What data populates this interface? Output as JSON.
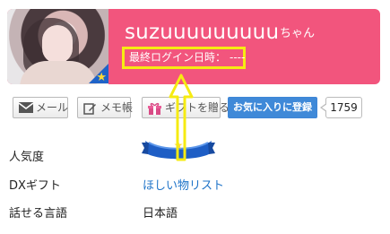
{
  "profile": {
    "name": "suzuuuuuuuuu",
    "honorific": "ちゃん",
    "last_login_label": "最終ログイン日時：",
    "last_login_value": "----"
  },
  "actions": {
    "mail_label": "メール",
    "memo_label": "メモ帳",
    "gift_label": "ギフトを贈る",
    "favorite_label": "お気に入りに登録",
    "favorite_count": "1759"
  },
  "details": {
    "popularity_label": "人気度",
    "gift_label": "DXギフト",
    "gift_value": "ほしい物リスト",
    "language_label": "話せる言語",
    "language_value": "日本語"
  },
  "colors": {
    "header": "#f2557d",
    "favorite": "#3f89d8",
    "highlight": "#f6eb12",
    "link": "#1e73c8"
  },
  "icons": {
    "mail": "mail-icon",
    "memo": "memo-icon",
    "gift": "gift-icon",
    "star": "star-icon",
    "arrow": "up-arrow-icon"
  }
}
